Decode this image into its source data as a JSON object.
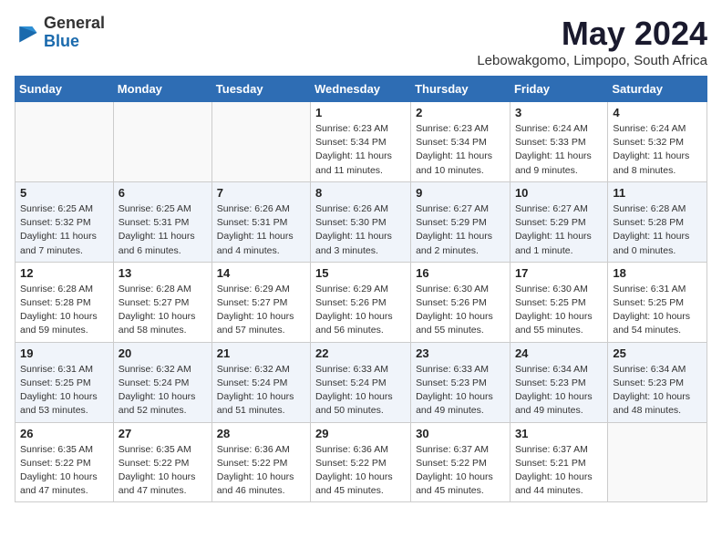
{
  "logo": {
    "general": "General",
    "blue": "Blue"
  },
  "title": "May 2024",
  "location": "Lebowakgomo, Limpopo, South Africa",
  "weekdays": [
    "Sunday",
    "Monday",
    "Tuesday",
    "Wednesday",
    "Thursday",
    "Friday",
    "Saturday"
  ],
  "weeks": [
    [
      {
        "day": "",
        "info": ""
      },
      {
        "day": "",
        "info": ""
      },
      {
        "day": "",
        "info": ""
      },
      {
        "day": "1",
        "info": "Sunrise: 6:23 AM\nSunset: 5:34 PM\nDaylight: 11 hours\nand 11 minutes."
      },
      {
        "day": "2",
        "info": "Sunrise: 6:23 AM\nSunset: 5:34 PM\nDaylight: 11 hours\nand 10 minutes."
      },
      {
        "day": "3",
        "info": "Sunrise: 6:24 AM\nSunset: 5:33 PM\nDaylight: 11 hours\nand 9 minutes."
      },
      {
        "day": "4",
        "info": "Sunrise: 6:24 AM\nSunset: 5:32 PM\nDaylight: 11 hours\nand 8 minutes."
      }
    ],
    [
      {
        "day": "5",
        "info": "Sunrise: 6:25 AM\nSunset: 5:32 PM\nDaylight: 11 hours\nand 7 minutes."
      },
      {
        "day": "6",
        "info": "Sunrise: 6:25 AM\nSunset: 5:31 PM\nDaylight: 11 hours\nand 6 minutes."
      },
      {
        "day": "7",
        "info": "Sunrise: 6:26 AM\nSunset: 5:31 PM\nDaylight: 11 hours\nand 4 minutes."
      },
      {
        "day": "8",
        "info": "Sunrise: 6:26 AM\nSunset: 5:30 PM\nDaylight: 11 hours\nand 3 minutes."
      },
      {
        "day": "9",
        "info": "Sunrise: 6:27 AM\nSunset: 5:29 PM\nDaylight: 11 hours\nand 2 minutes."
      },
      {
        "day": "10",
        "info": "Sunrise: 6:27 AM\nSunset: 5:29 PM\nDaylight: 11 hours\nand 1 minute."
      },
      {
        "day": "11",
        "info": "Sunrise: 6:28 AM\nSunset: 5:28 PM\nDaylight: 11 hours\nand 0 minutes."
      }
    ],
    [
      {
        "day": "12",
        "info": "Sunrise: 6:28 AM\nSunset: 5:28 PM\nDaylight: 10 hours\nand 59 minutes."
      },
      {
        "day": "13",
        "info": "Sunrise: 6:28 AM\nSunset: 5:27 PM\nDaylight: 10 hours\nand 58 minutes."
      },
      {
        "day": "14",
        "info": "Sunrise: 6:29 AM\nSunset: 5:27 PM\nDaylight: 10 hours\nand 57 minutes."
      },
      {
        "day": "15",
        "info": "Sunrise: 6:29 AM\nSunset: 5:26 PM\nDaylight: 10 hours\nand 56 minutes."
      },
      {
        "day": "16",
        "info": "Sunrise: 6:30 AM\nSunset: 5:26 PM\nDaylight: 10 hours\nand 55 minutes."
      },
      {
        "day": "17",
        "info": "Sunrise: 6:30 AM\nSunset: 5:25 PM\nDaylight: 10 hours\nand 55 minutes."
      },
      {
        "day": "18",
        "info": "Sunrise: 6:31 AM\nSunset: 5:25 PM\nDaylight: 10 hours\nand 54 minutes."
      }
    ],
    [
      {
        "day": "19",
        "info": "Sunrise: 6:31 AM\nSunset: 5:25 PM\nDaylight: 10 hours\nand 53 minutes."
      },
      {
        "day": "20",
        "info": "Sunrise: 6:32 AM\nSunset: 5:24 PM\nDaylight: 10 hours\nand 52 minutes."
      },
      {
        "day": "21",
        "info": "Sunrise: 6:32 AM\nSunset: 5:24 PM\nDaylight: 10 hours\nand 51 minutes."
      },
      {
        "day": "22",
        "info": "Sunrise: 6:33 AM\nSunset: 5:24 PM\nDaylight: 10 hours\nand 50 minutes."
      },
      {
        "day": "23",
        "info": "Sunrise: 6:33 AM\nSunset: 5:23 PM\nDaylight: 10 hours\nand 49 minutes."
      },
      {
        "day": "24",
        "info": "Sunrise: 6:34 AM\nSunset: 5:23 PM\nDaylight: 10 hours\nand 49 minutes."
      },
      {
        "day": "25",
        "info": "Sunrise: 6:34 AM\nSunset: 5:23 PM\nDaylight: 10 hours\nand 48 minutes."
      }
    ],
    [
      {
        "day": "26",
        "info": "Sunrise: 6:35 AM\nSunset: 5:22 PM\nDaylight: 10 hours\nand 47 minutes."
      },
      {
        "day": "27",
        "info": "Sunrise: 6:35 AM\nSunset: 5:22 PM\nDaylight: 10 hours\nand 47 minutes."
      },
      {
        "day": "28",
        "info": "Sunrise: 6:36 AM\nSunset: 5:22 PM\nDaylight: 10 hours\nand 46 minutes."
      },
      {
        "day": "29",
        "info": "Sunrise: 6:36 AM\nSunset: 5:22 PM\nDaylight: 10 hours\nand 45 minutes."
      },
      {
        "day": "30",
        "info": "Sunrise: 6:37 AM\nSunset: 5:22 PM\nDaylight: 10 hours\nand 45 minutes."
      },
      {
        "day": "31",
        "info": "Sunrise: 6:37 AM\nSunset: 5:21 PM\nDaylight: 10 hours\nand 44 minutes."
      },
      {
        "day": "",
        "info": ""
      }
    ]
  ]
}
